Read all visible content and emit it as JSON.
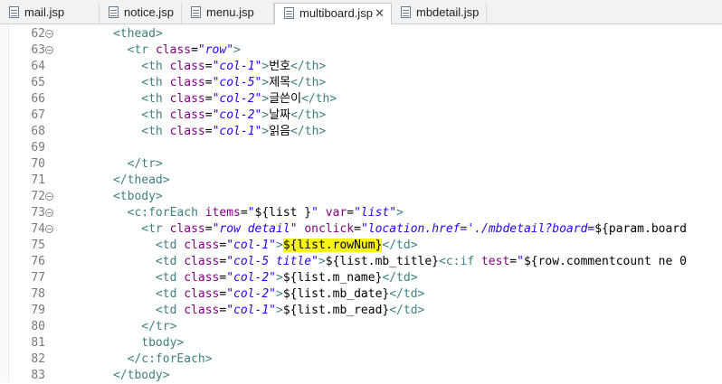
{
  "tabs": [
    {
      "label": "mail.jsp",
      "active": false
    },
    {
      "label": "notice.jsp",
      "active": false
    },
    {
      "label": "menu.jsp",
      "active": false
    },
    {
      "label": "multiboard.jsp",
      "active": true
    },
    {
      "label": "mbdetail.jsp",
      "active": false
    }
  ],
  "tab_close_glyph": "✕",
  "fold_glyph": "⊖",
  "colors": {
    "tag": "#3f7f7f",
    "attribute": "#7f007f",
    "value": "#2a00ff",
    "highlight": "#f7f312",
    "line_number": "#787878"
  },
  "lines": [
    {
      "num": "62",
      "fold": true,
      "seg": [
        [
          "      ",
          "p"
        ],
        [
          "<thead>",
          "t"
        ]
      ]
    },
    {
      "num": "63",
      "fold": true,
      "seg": [
        [
          "        ",
          "p"
        ],
        [
          "<tr ",
          "t"
        ],
        [
          "class",
          "a"
        ],
        [
          "=",
          "p"
        ],
        [
          "\"row\"",
          "v"
        ],
        [
          ">",
          "t"
        ]
      ]
    },
    {
      "num": "64",
      "fold": false,
      "seg": [
        [
          "          ",
          "p"
        ],
        [
          "<th ",
          "t"
        ],
        [
          "class",
          "a"
        ],
        [
          "=",
          "p"
        ],
        [
          "\"col-1\"",
          "v"
        ],
        [
          ">",
          "t"
        ],
        [
          "번호",
          "p"
        ],
        [
          "</th>",
          "t"
        ]
      ]
    },
    {
      "num": "65",
      "fold": false,
      "seg": [
        [
          "          ",
          "p"
        ],
        [
          "<th ",
          "t"
        ],
        [
          "class",
          "a"
        ],
        [
          "=",
          "p"
        ],
        [
          "\"col-5\"",
          "v"
        ],
        [
          ">",
          "t"
        ],
        [
          "제목",
          "p"
        ],
        [
          "</th>",
          "t"
        ]
      ]
    },
    {
      "num": "66",
      "fold": false,
      "seg": [
        [
          "          ",
          "p"
        ],
        [
          "<th ",
          "t"
        ],
        [
          "class",
          "a"
        ],
        [
          "=",
          "p"
        ],
        [
          "\"col-2\"",
          "v"
        ],
        [
          ">",
          "t"
        ],
        [
          "글쓴이",
          "p"
        ],
        [
          "</th>",
          "t"
        ]
      ]
    },
    {
      "num": "67",
      "fold": false,
      "seg": [
        [
          "          ",
          "p"
        ],
        [
          "<th ",
          "t"
        ],
        [
          "class",
          "a"
        ],
        [
          "=",
          "p"
        ],
        [
          "\"col-2\"",
          "v"
        ],
        [
          ">",
          "t"
        ],
        [
          "날짜",
          "p"
        ],
        [
          "</th>",
          "t"
        ]
      ]
    },
    {
      "num": "68",
      "fold": false,
      "seg": [
        [
          "          ",
          "p"
        ],
        [
          "<th ",
          "t"
        ],
        [
          "class",
          "a"
        ],
        [
          "=",
          "p"
        ],
        [
          "\"col-1\"",
          "v"
        ],
        [
          ">",
          "t"
        ],
        [
          "읽음",
          "p"
        ],
        [
          "</th>",
          "t"
        ]
      ]
    },
    {
      "num": "69",
      "fold": false,
      "seg": []
    },
    {
      "num": "70",
      "fold": false,
      "seg": [
        [
          "        ",
          "p"
        ],
        [
          "</tr>",
          "t"
        ]
      ]
    },
    {
      "num": "71",
      "fold": false,
      "seg": [
        [
          "      ",
          "p"
        ],
        [
          "</thead>",
          "t"
        ]
      ]
    },
    {
      "num": "72",
      "fold": true,
      "seg": [
        [
          "      ",
          "p"
        ],
        [
          "<tbody>",
          "t"
        ]
      ]
    },
    {
      "num": "73",
      "fold": true,
      "seg": [
        [
          "        ",
          "p"
        ],
        [
          "<c:forEach ",
          "t"
        ],
        [
          "items",
          "a"
        ],
        [
          "=",
          "p"
        ],
        [
          "\"",
          "v"
        ],
        [
          "${list }",
          "p"
        ],
        [
          "\" ",
          "v"
        ],
        [
          "var",
          "a"
        ],
        [
          "=",
          "p"
        ],
        [
          "\"list\"",
          "v"
        ],
        [
          ">",
          "t"
        ]
      ]
    },
    {
      "num": "74",
      "fold": true,
      "seg": [
        [
          "          ",
          "p"
        ],
        [
          "<tr ",
          "t"
        ],
        [
          "class",
          "a"
        ],
        [
          "=",
          "p"
        ],
        [
          "\"row detail\" ",
          "v"
        ],
        [
          "onclick",
          "a"
        ],
        [
          "=",
          "p"
        ],
        [
          "\"location.href='./mbdetail?board=",
          "v"
        ],
        [
          "${param.board",
          "p"
        ]
      ]
    },
    {
      "num": "75",
      "fold": false,
      "seg": [
        [
          "            ",
          "p"
        ],
        [
          "<td ",
          "t"
        ],
        [
          "class",
          "a"
        ],
        [
          "=",
          "p"
        ],
        [
          "\"col-1\"",
          "v"
        ],
        [
          ">",
          "t"
        ],
        [
          "${list.rowNum}",
          "hl"
        ],
        [
          "</td>",
          "t"
        ]
      ]
    },
    {
      "num": "76",
      "fold": false,
      "seg": [
        [
          "            ",
          "p"
        ],
        [
          "<td ",
          "t"
        ],
        [
          "class",
          "a"
        ],
        [
          "=",
          "p"
        ],
        [
          "\"col-5 title\"",
          "v"
        ],
        [
          ">",
          "t"
        ],
        [
          "${list.mb_title}",
          "p"
        ],
        [
          "<c:if ",
          "t"
        ],
        [
          "test",
          "a"
        ],
        [
          "=",
          "p"
        ],
        [
          "\"",
          "v"
        ],
        [
          "${row.commentcount ne 0",
          "p"
        ]
      ]
    },
    {
      "num": "77",
      "fold": false,
      "seg": [
        [
          "            ",
          "p"
        ],
        [
          "<td ",
          "t"
        ],
        [
          "class",
          "a"
        ],
        [
          "=",
          "p"
        ],
        [
          "\"col-2\"",
          "v"
        ],
        [
          ">",
          "t"
        ],
        [
          "${list.m_name}",
          "p"
        ],
        [
          "</td>",
          "t"
        ]
      ]
    },
    {
      "num": "78",
      "fold": false,
      "seg": [
        [
          "            ",
          "p"
        ],
        [
          "<td ",
          "t"
        ],
        [
          "class",
          "a"
        ],
        [
          "=",
          "p"
        ],
        [
          "\"col-2\"",
          "v"
        ],
        [
          ">",
          "t"
        ],
        [
          "${list.mb_date}",
          "p"
        ],
        [
          "</td>",
          "t"
        ]
      ]
    },
    {
      "num": "79",
      "fold": false,
      "seg": [
        [
          "            ",
          "p"
        ],
        [
          "<td ",
          "t"
        ],
        [
          "class",
          "a"
        ],
        [
          "=",
          "p"
        ],
        [
          "\"col-1\"",
          "v"
        ],
        [
          ">",
          "t"
        ],
        [
          "${list.mb_read}",
          "p"
        ],
        [
          "</td>",
          "t"
        ]
      ]
    },
    {
      "num": "80",
      "fold": false,
      "seg": [
        [
          "          ",
          "p"
        ],
        [
          "</tr>",
          "t"
        ]
      ]
    },
    {
      "num": "81",
      "fold": false,
      "seg": [
        [
          "          ",
          "p"
        ],
        [
          "tbody>",
          "t"
        ]
      ]
    },
    {
      "num": "82",
      "fold": false,
      "seg": [
        [
          "        ",
          "p"
        ],
        [
          "</c:forEach>",
          "t"
        ]
      ]
    },
    {
      "num": "83",
      "fold": false,
      "seg": [
        [
          "      ",
          "p"
        ],
        [
          "</tbody>",
          "t"
        ]
      ]
    }
  ]
}
